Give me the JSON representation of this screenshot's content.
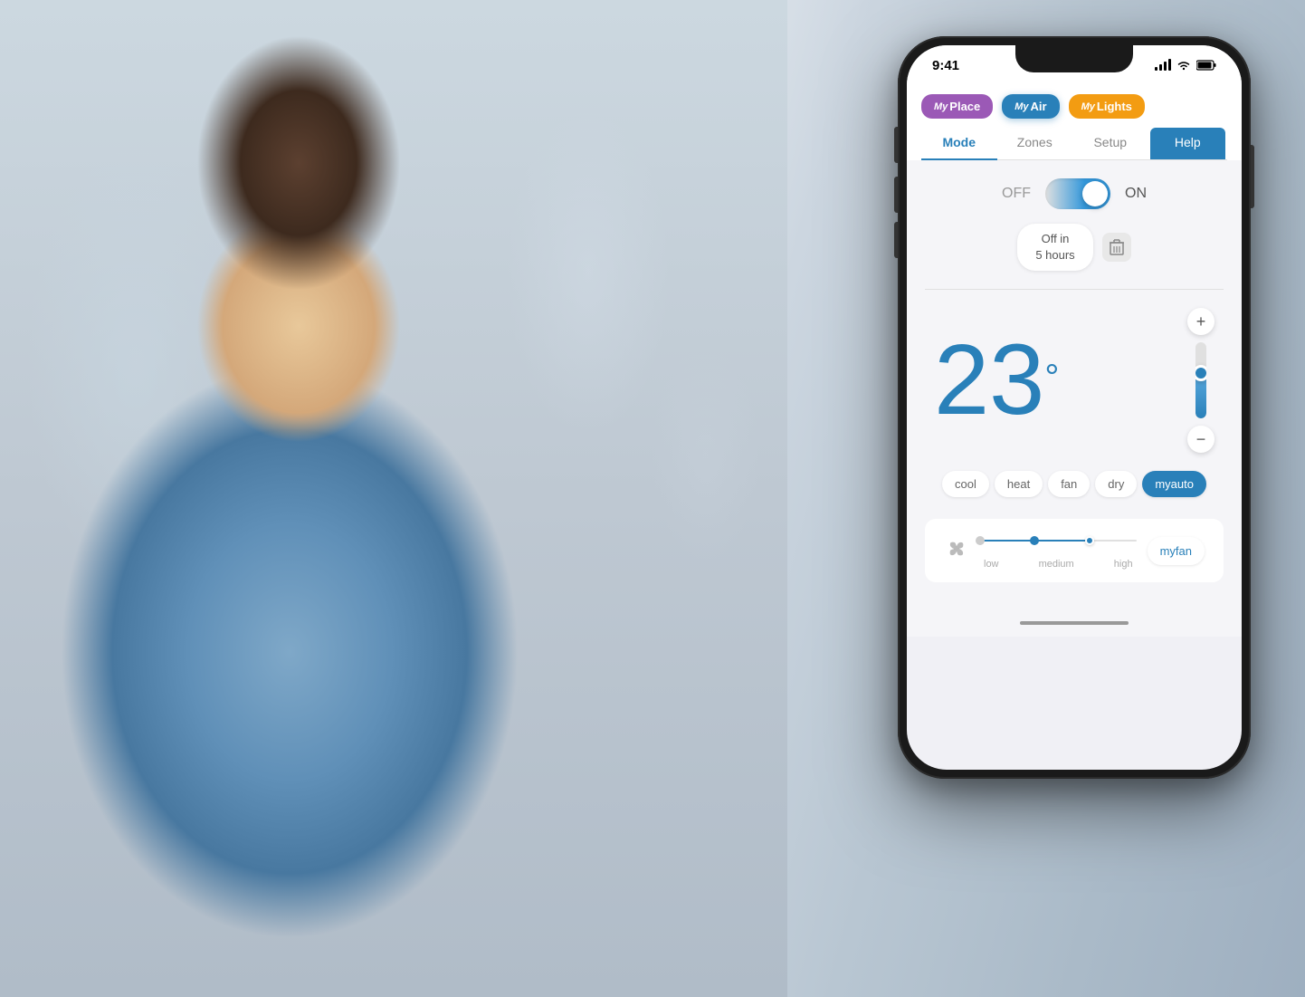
{
  "background": {
    "color": "#c0ccd8"
  },
  "statusBar": {
    "time": "9:41",
    "signal": "●●●",
    "wifi": "wifi",
    "battery": "battery"
  },
  "appTabs": [
    {
      "id": "myplace",
      "prefix": "My",
      "name": "Place",
      "color": "#9b59b6"
    },
    {
      "id": "myair",
      "prefix": "My",
      "name": "Air",
      "color": "#2980b9",
      "active": true
    },
    {
      "id": "mylights",
      "prefix": "My",
      "name": "Lights",
      "color": "#f39c12"
    }
  ],
  "navTabs": [
    {
      "id": "mode",
      "label": "Mode",
      "active": true
    },
    {
      "id": "zones",
      "label": "Zones"
    },
    {
      "id": "setup",
      "label": "Setup"
    },
    {
      "id": "help",
      "label": "Help",
      "special": true
    }
  ],
  "controls": {
    "powerOff": "OFF",
    "powerOn": "ON",
    "timerLabel": "Off in\n5 hours",
    "timerLabelLine1": "Off in",
    "timerLabelLine2": "5 hours",
    "temperature": "23",
    "tempUnit": "°",
    "temperaturePlus": "+",
    "temperatureMinus": "−"
  },
  "modes": [
    {
      "id": "cool",
      "label": "cool",
      "active": false
    },
    {
      "id": "heat",
      "label": "heat",
      "active": false
    },
    {
      "id": "fan",
      "label": "fan",
      "active": false
    },
    {
      "id": "dry",
      "label": "dry",
      "active": false
    },
    {
      "id": "myauto",
      "label": "myauto",
      "active": true
    }
  ],
  "fan": {
    "iconLabel": "fan-icon",
    "positions": [
      "low",
      "medium",
      "high"
    ],
    "activePosition": 2,
    "myfanLabel": "myfan"
  }
}
